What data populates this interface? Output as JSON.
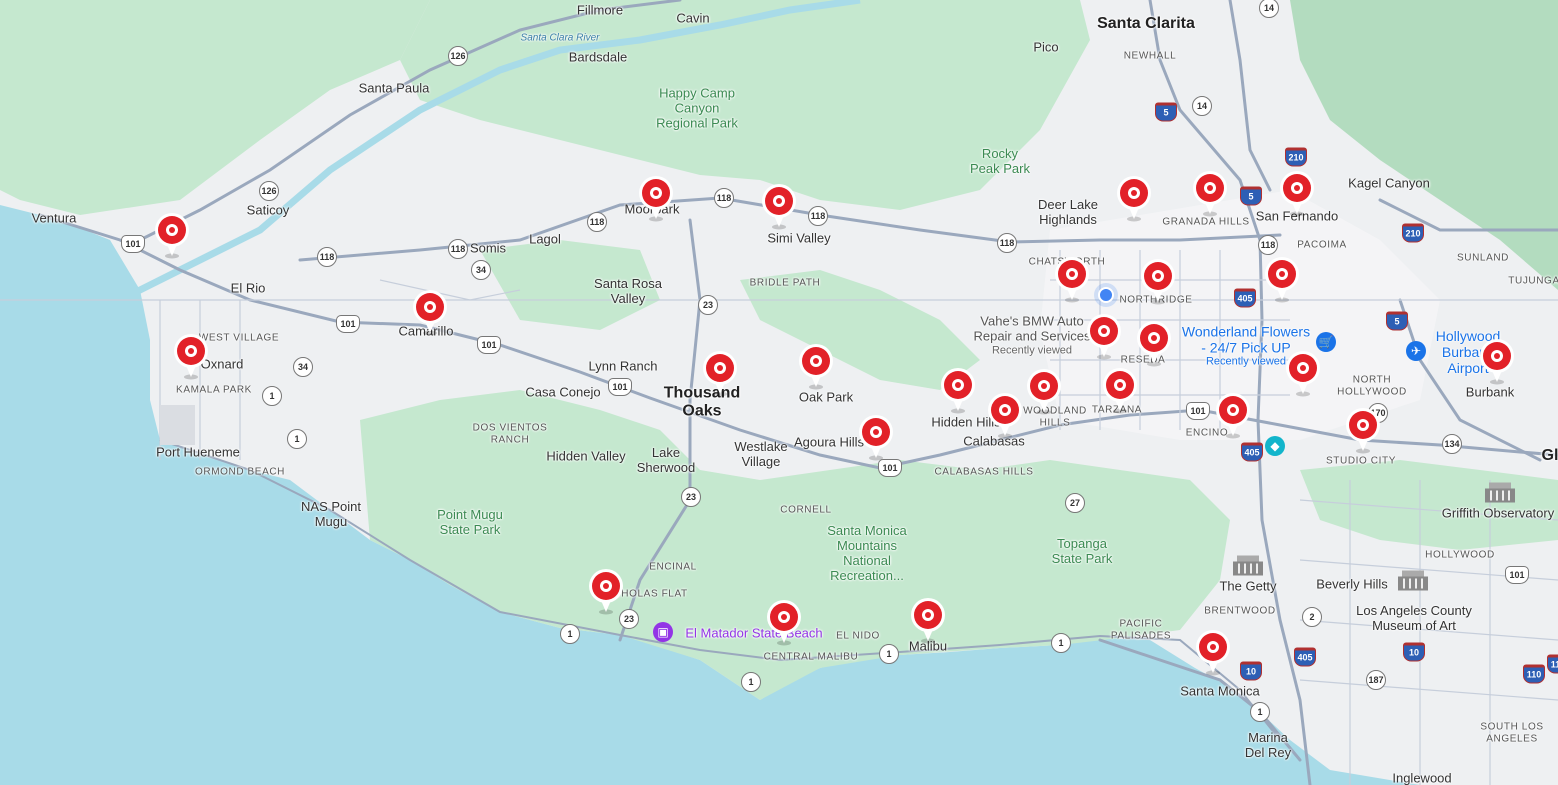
{
  "map": {
    "colors": {
      "water": "#a8dbe8",
      "land": "#eef0f2",
      "park": "#c5e8cf",
      "park_dark": "#b3dcbf",
      "road": "#9aa8bd",
      "pin": "#e22128"
    },
    "labels": [
      {
        "text": "Santa Clarita",
        "kind": "big",
        "name": "santa-clarita-label"
      },
      {
        "text": "Fillmore",
        "kind": "city",
        "name": "fillmore-label"
      },
      {
        "text": "Cavin",
        "kind": "city",
        "name": "cavin-label"
      },
      {
        "text": "Bardsdale",
        "kind": "city",
        "name": "bardsdale-label"
      },
      {
        "text": "Santa Paula",
        "kind": "city",
        "name": "santa-paula-label"
      },
      {
        "text": "Pico",
        "kind": "city",
        "name": "pico-label"
      },
      {
        "text": "NEWHALL",
        "kind": "hood",
        "name": "newhall-label"
      },
      {
        "text": "Santa Clara River",
        "kind": "water",
        "name": "santa-clara-river-label"
      },
      {
        "text": "Happy Camp\nCanyon\nRegional Park",
        "kind": "park",
        "name": "happy-camp-park-label"
      },
      {
        "text": "Rocky\nPeak Park",
        "kind": "park",
        "name": "rocky-peak-park-label"
      },
      {
        "text": "Kagel Canyon",
        "kind": "city",
        "name": "kagel-canyon-label"
      },
      {
        "text": "Ventura",
        "kind": "city",
        "name": "ventura-label"
      },
      {
        "text": "Saticoy",
        "kind": "city",
        "name": "saticoy-label"
      },
      {
        "text": "Moorpark",
        "kind": "city",
        "name": "moorpark-label"
      },
      {
        "text": "Simi Valley",
        "kind": "city",
        "name": "simi-valley-label"
      },
      {
        "text": "Deer Lake\nHighlands",
        "kind": "city",
        "name": "deer-lake-highlands-label"
      },
      {
        "text": "GRANADA HILLS",
        "kind": "hood",
        "name": "granada-hills-label"
      },
      {
        "text": "San Fernando",
        "kind": "city",
        "name": "san-fernando-label"
      },
      {
        "text": "PACOIMA",
        "kind": "hood",
        "name": "pacoima-label"
      },
      {
        "text": "SUNLAND",
        "kind": "hood",
        "name": "sunland-label"
      },
      {
        "text": "TUJUNGA",
        "kind": "hood",
        "name": "tujunga-label"
      },
      {
        "text": "Somis",
        "kind": "city",
        "name": "somis-label"
      },
      {
        "text": "Lagol",
        "kind": "city",
        "name": "lagol-label"
      },
      {
        "text": "CHATSWORTH",
        "kind": "hood",
        "name": "chatsworth-label"
      },
      {
        "text": "NORTHRIDGE",
        "kind": "hood",
        "name": "northridge-label"
      },
      {
        "text": "El Rio",
        "kind": "city",
        "name": "el-rio-label"
      },
      {
        "text": "Santa Rosa\nValley",
        "kind": "city",
        "name": "santa-rosa-valley-label"
      },
      {
        "text": "BRIDLE PATH",
        "kind": "hood",
        "name": "bridle-path-label"
      },
      {
        "text": "WEST VILLAGE",
        "kind": "hood",
        "name": "west-village-label"
      },
      {
        "text": "Camarillo",
        "kind": "city",
        "name": "camarillo-label"
      },
      {
        "text": "Oxnard",
        "kind": "city",
        "name": "oxnard-label"
      },
      {
        "text": "KAMALA PARK",
        "kind": "hood",
        "name": "kamala-park-label"
      },
      {
        "text": "Lynn Ranch",
        "kind": "city",
        "name": "lynn-ranch-label"
      },
      {
        "text": "Thousand\nOaks",
        "kind": "big",
        "name": "thousand-oaks-label"
      },
      {
        "text": "Oak Park",
        "kind": "city",
        "name": "oak-park-label"
      },
      {
        "text": "RESEDA",
        "kind": "hood",
        "name": "reseda-label"
      },
      {
        "text": "NORTH\nHOLLYWOOD",
        "kind": "hood",
        "name": "north-hollywood-label"
      },
      {
        "text": "Burbank",
        "kind": "city",
        "name": "burbank-label"
      },
      {
        "text": "Casa Conejo",
        "kind": "city",
        "name": "casa-conejo-label"
      },
      {
        "text": "Hidden Hills",
        "kind": "city",
        "name": "hidden-hills-label"
      },
      {
        "text": "WOODLAND\nHILLS",
        "kind": "hood",
        "name": "woodland-hills-label"
      },
      {
        "text": "TARZANA",
        "kind": "hood",
        "name": "tarzana-label"
      },
      {
        "text": "ENCINO",
        "kind": "hood",
        "name": "encino-label"
      },
      {
        "text": "STUDIO CITY",
        "kind": "hood",
        "name": "studio-city-label"
      },
      {
        "text": "DOS VIENTOS\nRANCH",
        "kind": "hood",
        "name": "dos-vientos-ranch-label"
      },
      {
        "text": "Agoura Hills",
        "kind": "city",
        "name": "agoura-hills-label"
      },
      {
        "text": "Calabasas",
        "kind": "city",
        "name": "calabasas-label"
      },
      {
        "text": "Port Hueneme",
        "kind": "city",
        "name": "port-hueneme-label"
      },
      {
        "text": "Hidden Valley",
        "kind": "city",
        "name": "hidden-valley-label"
      },
      {
        "text": "Lake\nSherwood",
        "kind": "city",
        "name": "lake-sherwood-label"
      },
      {
        "text": "Westlake\nVillage",
        "kind": "city",
        "name": "westlake-village-label"
      },
      {
        "text": "CALABASAS HILLS",
        "kind": "hood",
        "name": "calabasas-hills-label"
      },
      {
        "text": "ORMOND BEACH",
        "kind": "hood",
        "name": "ormond-beach-label"
      },
      {
        "text": "NAS Point\nMugu",
        "kind": "city",
        "name": "nas-point-mugu-label"
      },
      {
        "text": "Point Mugu\nState Park",
        "kind": "park",
        "name": "point-mugu-state-park-label"
      },
      {
        "text": "CORNELL",
        "kind": "hood",
        "name": "cornell-label"
      },
      {
        "text": "Santa Monica\nMountains\nNational\nRecreation...",
        "kind": "park",
        "name": "santa-monica-mountains-label"
      },
      {
        "text": "Topanga\nState Park",
        "kind": "park",
        "name": "topanga-state-park-label"
      },
      {
        "text": "ENCINAL",
        "kind": "hood",
        "name": "encinal-label"
      },
      {
        "text": "NICHOLAS FLAT",
        "kind": "hood",
        "name": "nicholas-flat-label"
      },
      {
        "text": "EL NIDO",
        "kind": "hood",
        "name": "el-nido-label"
      },
      {
        "text": "CENTRAL MALIBU",
        "kind": "hood",
        "name": "central-malibu-label"
      },
      {
        "text": "Malibu",
        "kind": "city",
        "name": "malibu-label"
      },
      {
        "text": "PACIFIC\nPALISADES",
        "kind": "hood",
        "name": "pacific-palisades-label"
      },
      {
        "text": "The Getty",
        "kind": "city",
        "name": "the-getty-label"
      },
      {
        "text": "BRENTWOOD",
        "kind": "hood",
        "name": "brentwood-label"
      },
      {
        "text": "Santa Monica",
        "kind": "city",
        "name": "santa-monica-label"
      },
      {
        "text": "Beverly Hills",
        "kind": "city",
        "name": "beverly-hills-label"
      },
      {
        "text": "Los Angeles County\nMuseum of Art",
        "kind": "city",
        "name": "lacma-label"
      },
      {
        "text": "Griffith Observatory",
        "kind": "city",
        "name": "griffith-observatory-label"
      },
      {
        "text": "HOLLYWOOD",
        "kind": "hood",
        "name": "hollywood-label"
      },
      {
        "text": "SOUTH LOS\nANGELES",
        "kind": "hood",
        "name": "south-los-angeles-label"
      },
      {
        "text": "Marina\nDel Rey",
        "kind": "city",
        "name": "marina-del-rey-label"
      },
      {
        "text": "Inglewood",
        "kind": "city",
        "name": "inglewood-label"
      },
      {
        "text": "Gl",
        "kind": "big",
        "name": "glendale-partial-label"
      }
    ],
    "beach_label": "El Matador State Beach",
    "poi": {
      "wonderland": {
        "title": "Wonderland Flowers\n- 24/7 Pick UP",
        "sub": "Recently viewed"
      },
      "airport": {
        "title": "Hollywood\nBurbank\nAirport"
      },
      "vahe": {
        "title": "Vahe's BMW Auto\nRepair and Services",
        "sub": "Recently viewed"
      }
    },
    "shields": [
      {
        "t": "st",
        "n": "126"
      },
      {
        "t": "st",
        "n": "126"
      },
      {
        "t": "st",
        "n": "14"
      },
      {
        "t": "st",
        "n": "14"
      },
      {
        "t": "is",
        "n": "5"
      },
      {
        "t": "is",
        "n": "5"
      },
      {
        "t": "is",
        "n": "5"
      },
      {
        "t": "is",
        "n": "210"
      },
      {
        "t": "is",
        "n": "210"
      },
      {
        "t": "st",
        "n": "118"
      },
      {
        "t": "st",
        "n": "118"
      },
      {
        "t": "st",
        "n": "118"
      },
      {
        "t": "st",
        "n": "118"
      },
      {
        "t": "st",
        "n": "118"
      },
      {
        "t": "st",
        "n": "118"
      },
      {
        "t": "st",
        "n": "118"
      },
      {
        "t": "us",
        "n": "101"
      },
      {
        "t": "us",
        "n": "101"
      },
      {
        "t": "us",
        "n": "101"
      },
      {
        "t": "us",
        "n": "101"
      },
      {
        "t": "us",
        "n": "101"
      },
      {
        "t": "us",
        "n": "101"
      },
      {
        "t": "us",
        "n": "101"
      },
      {
        "t": "st",
        "n": "34"
      },
      {
        "t": "st",
        "n": "34"
      },
      {
        "t": "st",
        "n": "23"
      },
      {
        "t": "st",
        "n": "23"
      },
      {
        "t": "st",
        "n": "23"
      },
      {
        "t": "st",
        "n": "1"
      },
      {
        "t": "st",
        "n": "1"
      },
      {
        "t": "st",
        "n": "1"
      },
      {
        "t": "st",
        "n": "1"
      },
      {
        "t": "st",
        "n": "1"
      },
      {
        "t": "st",
        "n": "1"
      },
      {
        "t": "st",
        "n": "1"
      },
      {
        "t": "st",
        "n": "27"
      },
      {
        "t": "is",
        "n": "405"
      },
      {
        "t": "is",
        "n": "405"
      },
      {
        "t": "is",
        "n": "405"
      },
      {
        "t": "st",
        "n": "170"
      },
      {
        "t": "st",
        "n": "134"
      },
      {
        "t": "st",
        "n": "2"
      },
      {
        "t": "is",
        "n": "10"
      },
      {
        "t": "is",
        "n": "10"
      },
      {
        "t": "st",
        "n": "187"
      },
      {
        "t": "is",
        "n": "110"
      },
      {
        "t": "is",
        "n": "110"
      }
    ],
    "pins": [
      {
        "name": "ventura-pin"
      },
      {
        "name": "oxnard-pin"
      },
      {
        "name": "camarillo-pin"
      },
      {
        "name": "moorpark-pin"
      },
      {
        "name": "simi-valley-pin"
      },
      {
        "name": "thousand-oaks-pin"
      },
      {
        "name": "oak-park-pin"
      },
      {
        "name": "agoura-hills-pin"
      },
      {
        "name": "calabasas-pin"
      },
      {
        "name": "hidden-hills-pin"
      },
      {
        "name": "woodland-hills-pin"
      },
      {
        "name": "tarzana-pin"
      },
      {
        "name": "reseda-pin"
      },
      {
        "name": "vahe-pin"
      },
      {
        "name": "chatsworth-pin"
      },
      {
        "name": "northridge-pin"
      },
      {
        "name": "deer-lake-pin"
      },
      {
        "name": "granada-hills-pin"
      },
      {
        "name": "san-fernando-pin"
      },
      {
        "name": "pacoima-pin"
      },
      {
        "name": "wonderland-pin"
      },
      {
        "name": "burbank-pin"
      },
      {
        "name": "encino-pin"
      },
      {
        "name": "studio-city-pin"
      },
      {
        "name": "santa-monica-pin"
      },
      {
        "name": "nicholas-flat-pin"
      },
      {
        "name": "el-matador-pin"
      },
      {
        "name": "malibu-pin"
      }
    ]
  }
}
